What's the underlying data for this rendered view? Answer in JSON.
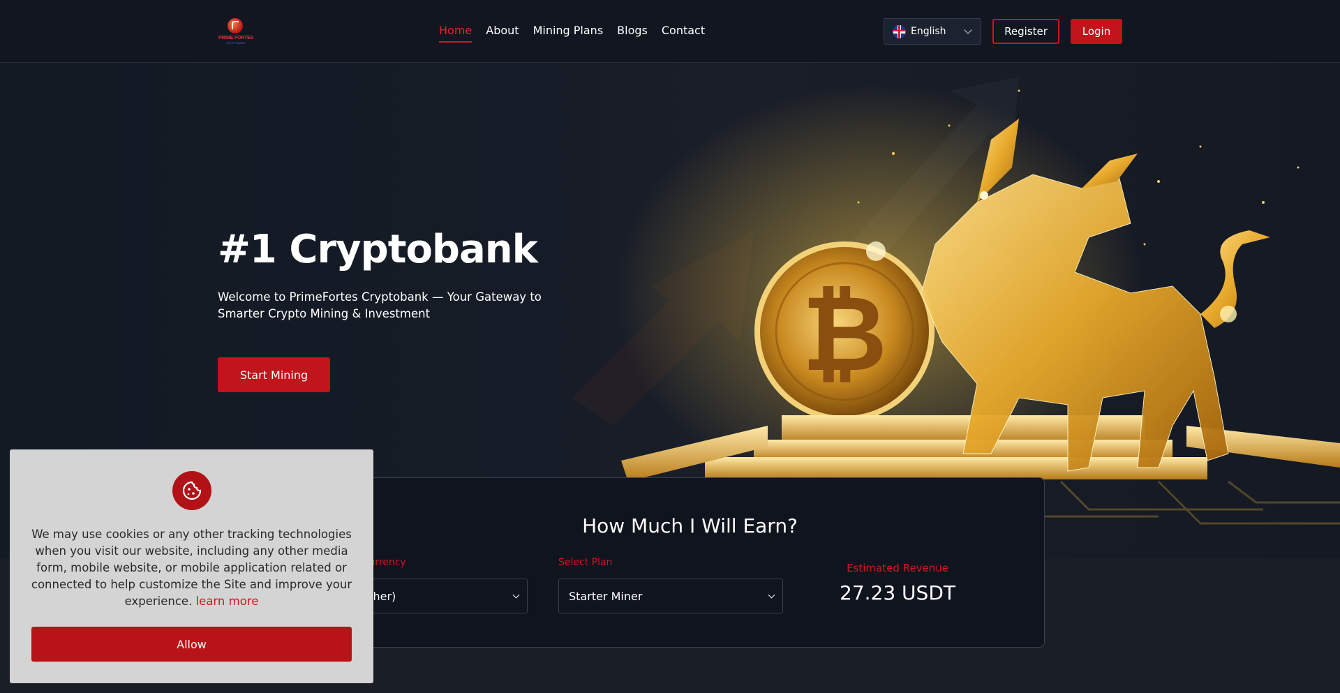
{
  "header": {
    "logo_text": "PRIME FORTES",
    "logo_subtext": "CRYPTOBANK",
    "nav": [
      {
        "label": "Home",
        "active": true
      },
      {
        "label": "About",
        "active": false
      },
      {
        "label": "Mining Plans",
        "active": false
      },
      {
        "label": "Blogs",
        "active": false
      },
      {
        "label": "Contact",
        "active": false
      }
    ],
    "language": {
      "selected": "English",
      "flag": "uk-flag-icon"
    },
    "register_label": "Register",
    "login_label": "Login"
  },
  "hero": {
    "title": "#1 Cryptobank",
    "subtitle": "Welcome to PrimeFortes Cryptobank — Your Gateway to Smarter Crypto Mining & Investment",
    "cta_label": "Start Mining",
    "image": "golden-bull-bitcoin-illustration"
  },
  "earnings": {
    "title": "How Much I Will Earn?",
    "currency_label": "Select Currency",
    "currency_value": "USDT (Tether)",
    "plan_label": "Select Plan",
    "plan_value": "Starter Miner",
    "revenue_label": "Estimated Revenue",
    "revenue_value": "27.23 USDT"
  },
  "cookie": {
    "icon": "cookie-icon",
    "text": "We may use cookies or any other tracking technologies when you visit our website, including any other media form, mobile website, or mobile application related or connected to help customize the Site and improve your experience.",
    "link_label": "learn more",
    "allow_label": "Allow"
  },
  "colors": {
    "accent": "#c1141b",
    "background": "#111620",
    "card": "#0f141e",
    "cookie_bg": "#d4d4d4"
  }
}
